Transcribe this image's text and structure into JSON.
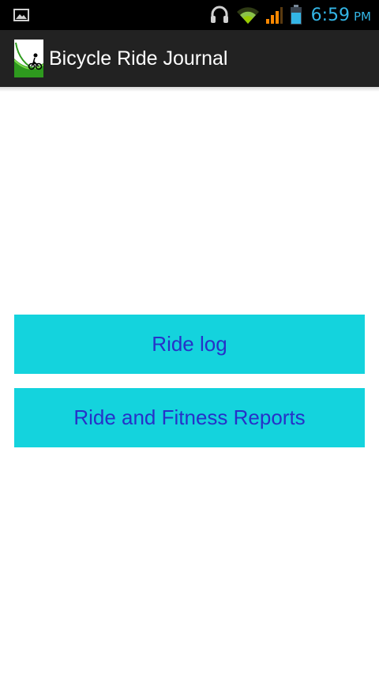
{
  "status_bar": {
    "time": "6:59",
    "ampm": "PM",
    "icons": [
      "image-notification-icon",
      "headset-icon",
      "wifi-icon",
      "signal-icon",
      "battery-icon"
    ],
    "accent_color": "#33b5e5"
  },
  "action_bar": {
    "title": "Bicycle Ride Journal",
    "icon": "bicycle-app-icon",
    "background": "#222222"
  },
  "menu": {
    "ride_log_label": "Ride log",
    "reports_label": "Ride and Fitness Reports",
    "button_color": "#14d3dd",
    "button_text_color": "#2731c8"
  }
}
